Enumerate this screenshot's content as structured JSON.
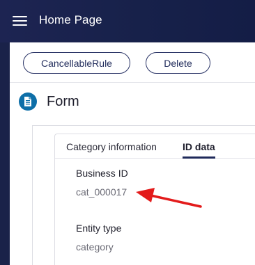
{
  "app": {
    "title": "Home Page",
    "menu_icon": "hamburger-menu-icon",
    "bar_color": "#1a2249"
  },
  "toolbar": {
    "cancellable_label": "CancellableRule",
    "delete_label": "Delete"
  },
  "form": {
    "title": "Form",
    "icon": "document-icon",
    "icon_color": "#0e6fa8"
  },
  "tabs": [
    {
      "label": "Category information",
      "active": false
    },
    {
      "label": "ID data",
      "active": true
    }
  ],
  "fields": {
    "business_id": {
      "label": "Business ID",
      "value": "cat_000017"
    },
    "entity_type": {
      "label": "Entity type",
      "value": "category"
    }
  },
  "annotation": {
    "type": "arrow",
    "color": "#e31b1b",
    "points_to": "business-id-value"
  }
}
